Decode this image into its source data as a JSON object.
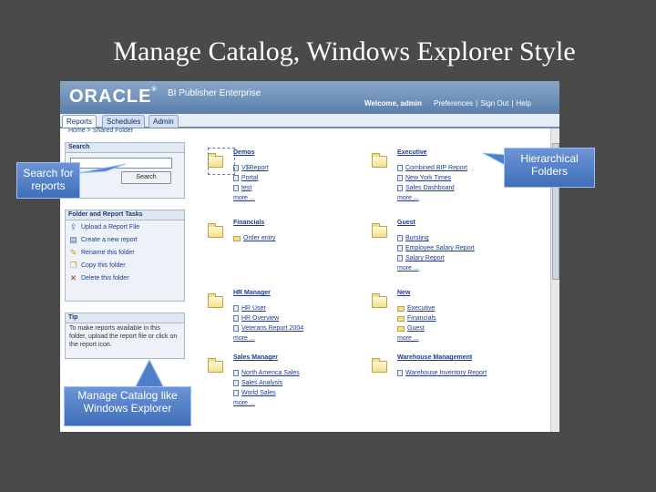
{
  "slide_title": "Manage Catalog, Windows Explorer Style",
  "banner": {
    "logo": "ORACLE",
    "product": "BI Publisher Enterprise",
    "welcome": "Welcome, admin",
    "links": [
      "Preferences",
      "Sign Out",
      "Help"
    ]
  },
  "tabs": [
    "Reports",
    "Schedules",
    "Admin"
  ],
  "breadcrumb": "Home > Shared Folder",
  "search": {
    "heading": "Search",
    "button": "Search"
  },
  "tasks": {
    "heading": "Folder and Report Tasks",
    "items": [
      {
        "icon": "upload-icon",
        "label": "Upload a Report File"
      },
      {
        "icon": "new-report-icon",
        "label": "Create a new report"
      },
      {
        "icon": "rename-icon",
        "label": "Rename this folder"
      },
      {
        "icon": "copy-icon",
        "label": "Copy this folder"
      },
      {
        "icon": "delete-icon",
        "label": "Delete this folder"
      }
    ]
  },
  "tip": {
    "heading": "Tip",
    "text": "To make reports available in this folder, upload the report file or click on the report icon."
  },
  "folders": [
    {
      "name": "Demos",
      "items": [
        {
          "t": "r",
          "l": "V$Report"
        },
        {
          "t": "r",
          "l": "Portal"
        },
        {
          "t": "r",
          "l": "test"
        }
      ],
      "more": "more ..."
    },
    {
      "name": "Executive",
      "items": [
        {
          "t": "r",
          "l": "Combined BIP Report"
        },
        {
          "t": "r",
          "l": "New York Times"
        },
        {
          "t": "r",
          "l": "Sales Dashboard"
        }
      ],
      "more": "more ..."
    },
    {
      "name": "Financials",
      "items": [
        {
          "t": "f",
          "l": "Order entry"
        }
      ],
      "more": ""
    },
    {
      "name": "Guest",
      "items": [
        {
          "t": "r",
          "l": "Bursting"
        },
        {
          "t": "r",
          "l": "Employee Salary Report"
        },
        {
          "t": "r",
          "l": "Salary Report"
        }
      ],
      "more": "more ..."
    },
    {
      "name": "HR Manager",
      "items": [
        {
          "t": "r",
          "l": "HR User"
        },
        {
          "t": "r",
          "l": "HR Overview"
        },
        {
          "t": "r",
          "l": "Veterans Report 2004"
        }
      ],
      "more": "more ..."
    },
    {
      "name": "New",
      "items": [
        {
          "t": "f",
          "l": "Executive"
        },
        {
          "t": "f",
          "l": "Financials"
        },
        {
          "t": "f",
          "l": "Guest"
        }
      ],
      "more": "more ..."
    },
    {
      "name": "Sales Manager",
      "items": [
        {
          "t": "r",
          "l": "North America Sales"
        },
        {
          "t": "r",
          "l": "Sales Analysis"
        },
        {
          "t": "r",
          "l": "World Sales"
        }
      ],
      "more": "more ..."
    },
    {
      "name": "Warehouse Management",
      "items": [
        {
          "t": "r",
          "l": "Warehouse Inventory Report"
        }
      ],
      "more": ""
    }
  ],
  "callouts": {
    "search": "Search for reports",
    "hierarchical": "Hierarchical Folders",
    "manage": "Manage Catalog like Windows Explorer"
  }
}
